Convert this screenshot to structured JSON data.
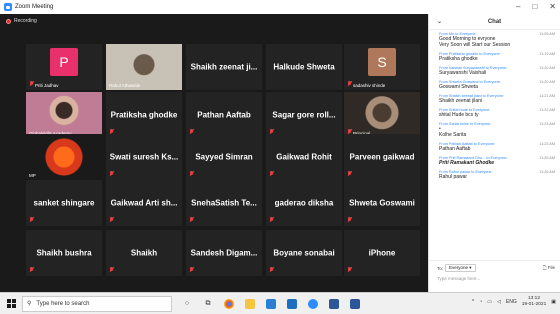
{
  "window": {
    "title": "Zoom Meeting",
    "min": "–",
    "max": "□",
    "close": "✕"
  },
  "recording": "Recording",
  "tiles": [
    {
      "name": "P",
      "label": "Priti Jadhav",
      "muted": true
    },
    {
      "name": "",
      "label": "Rahul Athawale",
      "muted": false
    },
    {
      "name": "Shaikh zeenat ji...",
      "label": "",
      "muted": false
    },
    {
      "name": "Halkude Shweta",
      "label": "",
      "muted": false
    },
    {
      "name": "S",
      "label": "sadashiv shinde",
      "muted": true
    },
    {
      "name": "",
      "label": "Globalskills Academy",
      "muted": false
    },
    {
      "name": "Pratiksha ghodke",
      "label": "",
      "muted": true
    },
    {
      "name": "Pathan Aaftab",
      "label": "",
      "muted": true
    },
    {
      "name": "Sagar gore roll...",
      "label": "",
      "muted": true
    },
    {
      "name": "",
      "label": "Principal",
      "muted": true
    },
    {
      "name": "",
      "label": "MP",
      "muted": false
    },
    {
      "name": "Swati suresh Ks...",
      "label": "",
      "muted": true
    },
    {
      "name": "Sayyed Simran",
      "label": "",
      "muted": true
    },
    {
      "name": "Gaikwad Rohit",
      "label": "",
      "muted": true
    },
    {
      "name": "Parveen gaikwad",
      "label": "",
      "muted": true
    },
    {
      "name": "sanket shingare",
      "label": "",
      "muted": true
    },
    {
      "name": "Gaikwad Arti sh...",
      "label": "",
      "muted": true
    },
    {
      "name": "SnehaSatish Te...",
      "label": "",
      "muted": true
    },
    {
      "name": "gaderao diksha",
      "label": "",
      "muted": true
    },
    {
      "name": "Shweta Goswami",
      "label": "",
      "muted": true
    },
    {
      "name": "Shaikh bushra",
      "label": "",
      "muted": true
    },
    {
      "name": "Shaikh",
      "label": "",
      "muted": true
    },
    {
      "name": "Sandesh Digam...",
      "label": "",
      "muted": true
    },
    {
      "name": "Boyane sonabai",
      "label": "",
      "muted": true
    },
    {
      "name": "iPhone",
      "label": "",
      "muted": true
    }
  ],
  "avatar_colors": {
    "P": "#e8306c",
    "S": "#b0785a"
  },
  "chat": {
    "title": "Chat",
    "messages": [
      {
        "from": "From Me to Everyone:",
        "time": "11:05 AM",
        "text": "Good Morning to evryone",
        "text2": "Very Soon will Start our Session",
        "style": ""
      },
      {
        "from": "From Pratiksha ghodke to Everyone:",
        "time": "11:19 AM",
        "text": "Pratiksha ghodke",
        "text2": "",
        "style": ""
      },
      {
        "from": "From Vaishali Suryawanshi to Everyone:",
        "time": "11:20 AM",
        "text": "Suryawanshi Vaishali",
        "text2": "",
        "style": ""
      },
      {
        "from": "From Shweta Goswami to Everyone:",
        "time": "11:20 AM",
        "text": "Goswami Shweta",
        "text2": "",
        "style": ""
      },
      {
        "from": "From Shaikh zeenat jilani to Everyone:",
        "time": "11:21 AM",
        "text": "Shaikh zeenat jilani",
        "text2": "",
        "style": ""
      },
      {
        "from": "From Shital hude to Everyone:",
        "time": "11:22 AM",
        "text": "shital Hude bcs ty",
        "text2": "",
        "style": ""
      },
      {
        "from": "From Sarita kolhe to Everyone:",
        "time": "11:23 AM",
        "text": "•",
        "text2": "Kolhe Sarita",
        "style": ""
      },
      {
        "from": "From Pathan Aaftab to Everyone:",
        "time": "11:23 AM",
        "text": "Pathan Aaftab",
        "text2": "",
        "style": ""
      },
      {
        "from": "From Priti Ramakant Gho... to Everyone:",
        "time": "11:25 AM",
        "text": "Priti Ramakant Ghodke",
        "text2": "",
        "style": "bi"
      },
      {
        "from": "From Rahul pawar to Everyone:",
        "time": "11:26 AM",
        "text": "Rahul pawar",
        "text2": "",
        "style": ""
      }
    ],
    "to_label": "To:",
    "to_value": "Everyone ▾",
    "file_label": "File",
    "input_placeholder": "Type message here..."
  },
  "taskbar": {
    "search_placeholder": "Type here to search",
    "lang": "ENG",
    "time": "13:12",
    "date": "19-01-2021"
  }
}
